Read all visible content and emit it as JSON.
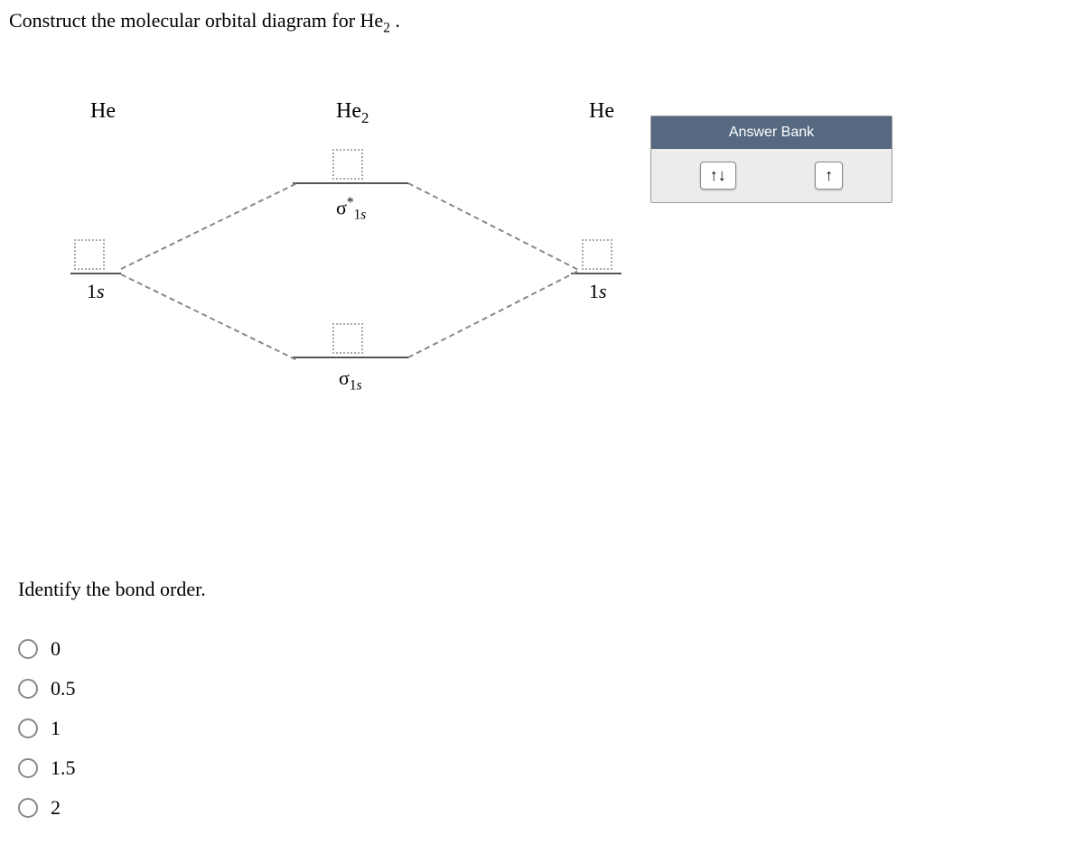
{
  "question": {
    "prefix": "Construct the molecular orbital diagram for ",
    "molecule_base": "He",
    "molecule_sub": "2",
    "suffix": " ."
  },
  "diagram": {
    "left_atom": "He",
    "center_molecule_base": "He",
    "center_molecule_sub": "2",
    "right_atom": "He",
    "left_orbital_num": "1",
    "left_orbital_letter": "s",
    "right_orbital_num": "1",
    "right_orbital_letter": "s",
    "sigma_star_sym": "σ",
    "sigma_star_sup": "*",
    "sigma_star_num": "1",
    "sigma_star_letter": "s",
    "sigma_sym": "σ",
    "sigma_num": "1",
    "sigma_letter": "s"
  },
  "answer_bank": {
    "title": "Answer Bank",
    "tiles": [
      "↑↓",
      "↑"
    ]
  },
  "bond_order": {
    "title": "Identify the bond order.",
    "options": [
      "0",
      "0.5",
      "1",
      "1.5",
      "2"
    ]
  }
}
